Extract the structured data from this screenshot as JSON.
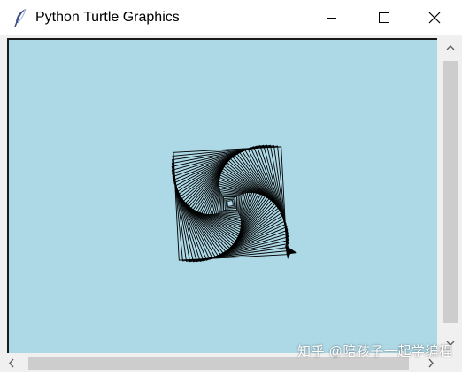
{
  "window": {
    "title": "Python Turtle Graphics",
    "icon": "feather-icon",
    "controls": [
      "minimize-icon",
      "maximize-icon",
      "close-icon"
    ]
  },
  "canvas": {
    "background_color": "#add8e6",
    "pen_color": "#000000",
    "turtle_icon": "arrow-turtle-icon"
  },
  "watermark": {
    "text": "知乎 @陪孩子一起学编程"
  },
  "scrollbars": {
    "vertical": {
      "up_icon": "chevron-up-icon",
      "down_icon": "chevron-down-icon"
    },
    "horizontal": {
      "left_icon": "chevron-left-icon",
      "right_icon": "chevron-right-icon"
    }
  }
}
